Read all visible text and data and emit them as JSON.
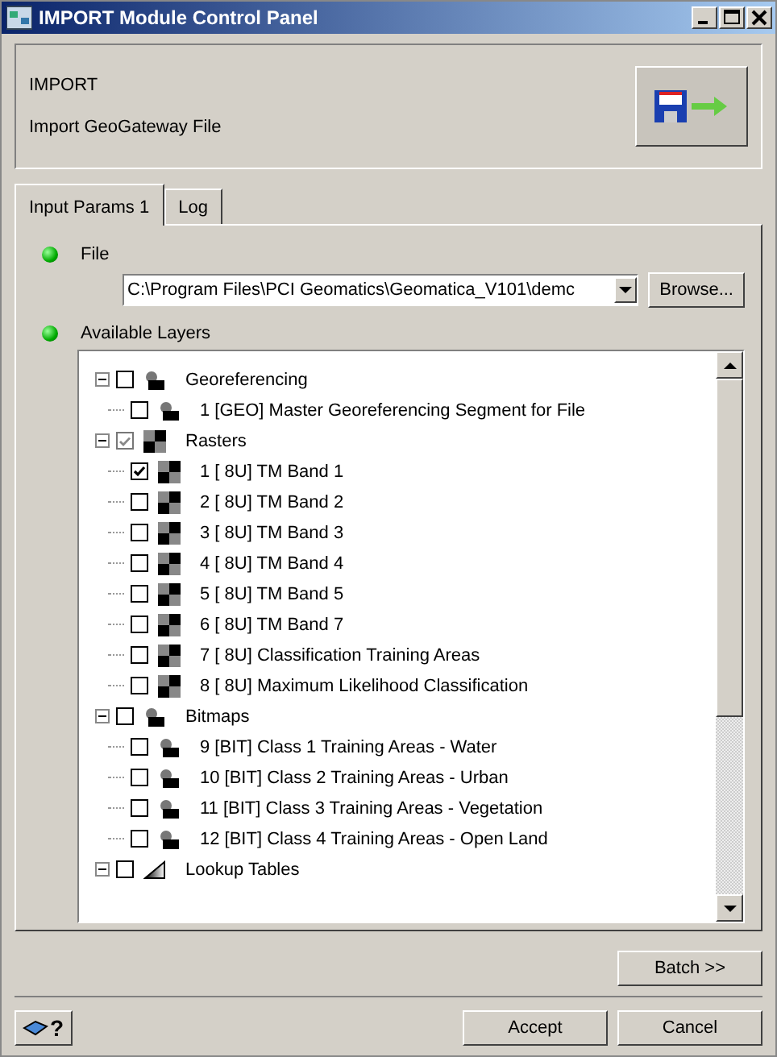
{
  "window": {
    "title": "IMPORT Module Control Panel"
  },
  "header": {
    "title": "IMPORT",
    "subtitle": "Import GeoGateway File"
  },
  "tabs": [
    {
      "label": "Input Params 1",
      "selected": true
    },
    {
      "label": "Log",
      "selected": false
    }
  ],
  "file": {
    "label": "File",
    "status_on": true,
    "value": "C:\\Program Files\\PCI Geomatics\\Geomatica_V101\\demc",
    "browse": "Browse..."
  },
  "layers": {
    "label": "Available Layers",
    "status_on": true,
    "tree": [
      {
        "label": "Georeferencing",
        "kind": "vector",
        "partial": false,
        "expanded": true,
        "children": [
          {
            "label": "1 [GEO] Master Georeferencing Segment for File",
            "kind": "vector",
            "checked": false
          }
        ]
      },
      {
        "label": "Rasters",
        "kind": "raster",
        "partial": true,
        "expanded": true,
        "children": [
          {
            "label": "1 [ 8U] TM Band 1",
            "kind": "raster",
            "checked": true
          },
          {
            "label": "2 [ 8U] TM Band 2",
            "kind": "raster",
            "checked": false
          },
          {
            "label": "3 [ 8U] TM Band 3",
            "kind": "raster",
            "checked": false
          },
          {
            "label": "4 [ 8U] TM Band 4",
            "kind": "raster",
            "checked": false
          },
          {
            "label": "5 [ 8U] TM Band 5",
            "kind": "raster",
            "checked": false
          },
          {
            "label": "6 [ 8U] TM Band 7",
            "kind": "raster",
            "checked": false
          },
          {
            "label": "7 [ 8U] Classification Training Areas",
            "kind": "raster",
            "checked": false
          },
          {
            "label": "8 [ 8U] Maximum Likelihood Classification",
            "kind": "raster",
            "checked": false
          }
        ]
      },
      {
        "label": "Bitmaps",
        "kind": "vector",
        "partial": false,
        "expanded": true,
        "children": [
          {
            "label": "9 [BIT] Class 1 Training Areas - Water",
            "kind": "vector",
            "checked": false
          },
          {
            "label": "10 [BIT] Class 2 Training Areas - Urban",
            "kind": "vector",
            "checked": false
          },
          {
            "label": "11 [BIT] Class 3 Training Areas - Vegetation",
            "kind": "vector",
            "checked": false
          },
          {
            "label": "12 [BIT] Class 4 Training Areas - Open Land",
            "kind": "vector",
            "checked": false
          }
        ]
      },
      {
        "label": "Lookup Tables",
        "kind": "lut",
        "partial": false,
        "expanded": true
      }
    ]
  },
  "batch_button": "Batch >>",
  "help_button": "?",
  "buttons": [
    "Accept",
    "Cancel"
  ]
}
